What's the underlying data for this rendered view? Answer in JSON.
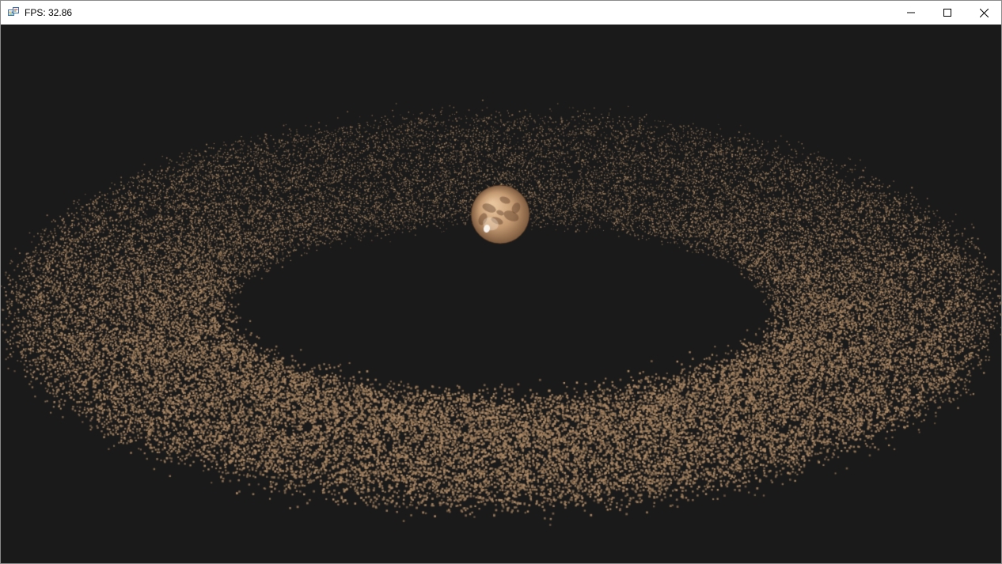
{
  "window": {
    "title": "FPS: 32.86",
    "app_icon": "winforms-app-icon",
    "controls": {
      "minimize_icon": "minimize-icon",
      "maximize_icon": "maximize-icon",
      "close_icon": "close-icon"
    }
  },
  "scene": {
    "background_color": "#1a1a1a",
    "planet": {
      "name": "mars-planet",
      "base_color": "#c49a72",
      "dark_color": "#7d5a3e"
    },
    "ring": {
      "particle_color": "#9a7a5a",
      "particle_color_light": "#b08c68"
    }
  }
}
